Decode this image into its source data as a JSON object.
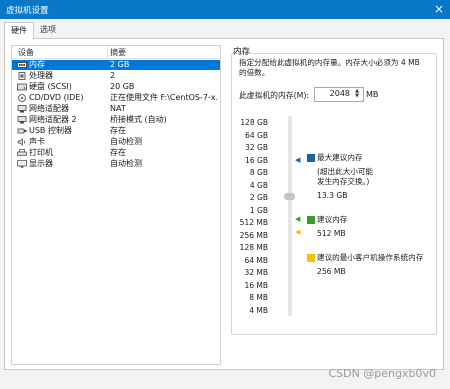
{
  "window": {
    "title": "虚拟机设置",
    "close": "×"
  },
  "tabs": [
    {
      "label": "硬件"
    },
    {
      "label": "选项"
    }
  ],
  "devices": {
    "headers": {
      "device": "设备",
      "summary": "摘要"
    },
    "items": [
      {
        "name": "内存",
        "summary": "2 GB",
        "icon": "memory-icon",
        "selected": true
      },
      {
        "name": "处理器",
        "summary": "2",
        "icon": "processor-icon"
      },
      {
        "name": "硬盘 (SCSI)",
        "summary": "20 GB",
        "icon": "hard-disk-icon"
      },
      {
        "name": "CD/DVD (IDE)",
        "summary": "正在使用文件 F:\\CentOS-7-x...",
        "icon": "cd-dvd-icon"
      },
      {
        "name": "网络适配器",
        "summary": "NAT",
        "icon": "network-adapter-icon"
      },
      {
        "name": "网络适配器 2",
        "summary": "桥接模式 (自动)",
        "icon": "network-adapter-icon"
      },
      {
        "name": "USB 控制器",
        "summary": "存在",
        "icon": "usb-icon"
      },
      {
        "name": "声卡",
        "summary": "自动检测",
        "icon": "sound-card-icon"
      },
      {
        "name": "打印机",
        "summary": "存在",
        "icon": "printer-icon"
      },
      {
        "name": "显示器",
        "summary": "自动检测",
        "icon": "display-icon"
      }
    ]
  },
  "memory": {
    "group_title": "内存",
    "description": "指定分配给此虚拟机的内存量。内存大小必须为 4 MB 的倍数。",
    "input_label": "此虚拟机的内存(M):",
    "value": "2048",
    "unit": "MB",
    "scale": [
      "128 GB",
      "64 GB",
      "32 GB",
      "16 GB",
      "8 GB",
      "4 GB",
      "2 GB",
      "1 GB",
      "512 MB",
      "256 MB",
      "128 MB",
      "64 MB",
      "32 MB",
      "16 MB",
      "8 MB",
      "4 MB"
    ],
    "slider_value": "2 GB",
    "max_recommended": {
      "label": "最大建议内存",
      "note1": "(超出此大小可能",
      "note2": "发生内存交换。)",
      "value": "13.3 GB",
      "color": "#1f5fa8"
    },
    "recommended": {
      "label": "建议内存",
      "value": "512 MB",
      "color": "#3a9c2a"
    },
    "guest_min": {
      "label": "建议的最小客户机操作系统内存",
      "value": "256 MB",
      "color": "#f0c400"
    }
  },
  "watermark": "CSDN @pengxb0v0"
}
